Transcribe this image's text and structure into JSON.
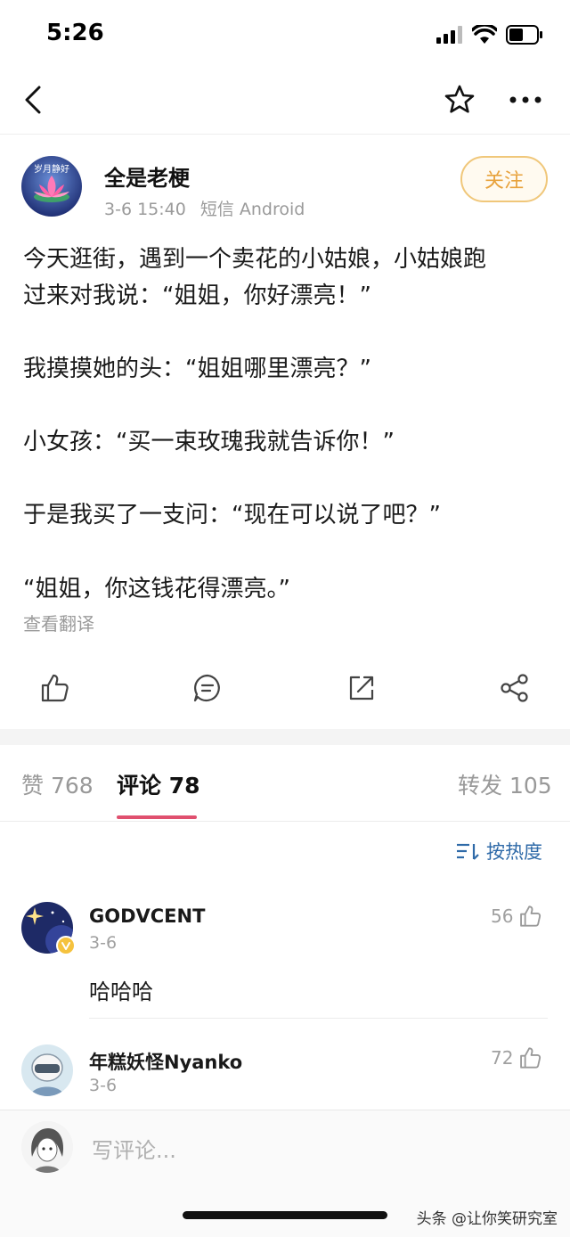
{
  "status_bar": {
    "time": "5:26"
  },
  "post": {
    "author": "全是老梗",
    "avatar_text": "岁月静好",
    "date": "3-6 15:40",
    "source": "短信 Android",
    "follow_label": "关注",
    "lines": [
      "今天逛街，遇到一个卖花的小姑娘，小姑娘跑",
      "过来对我说：“姐姐，你好漂亮！”",
      "我摸摸她的头：“姐姐哪里漂亮？”",
      "小女孩：“买一束玫瑰我就告诉你！”",
      "于是我买了一支问：“现在可以说了吧？”",
      "“姐姐，你这钱花得漂亮。”"
    ],
    "translate_label": "查看翻译"
  },
  "tabs": {
    "likes": "赞 768",
    "comments": "评论 78",
    "reposts": "转发 105"
  },
  "sort_label": "按热度",
  "comments": [
    {
      "user": "GODVCENT",
      "date": "3-6",
      "likes": "56",
      "text": "哈哈哈"
    },
    {
      "user": "年糕妖怪Nyanko",
      "date": "3-6",
      "likes": "72"
    }
  ],
  "input_placeholder": "写评论...",
  "watermark": "头条 @让你笑研究室",
  "colors": {
    "accent_pink": "#e0506f",
    "follow_orange": "#e8a23c",
    "sort_blue": "#2f6aa8"
  }
}
